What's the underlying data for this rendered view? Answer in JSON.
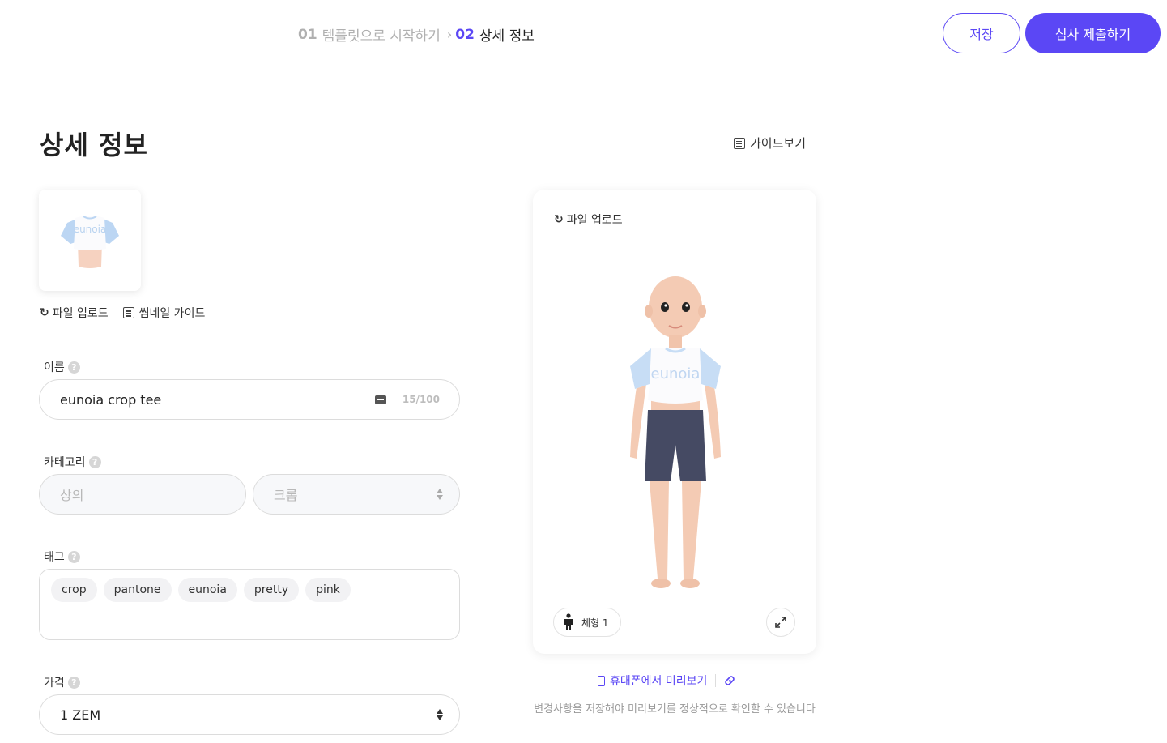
{
  "header": {
    "step1_num": "01",
    "step1_label": "템플릿으로 시작하기",
    "step2_num": "02",
    "step2_label": "상세 정보",
    "save_label": "저장",
    "submit_label": "심사 제출하기"
  },
  "page": {
    "title": "상세 정보",
    "guide_label": "가이드보기"
  },
  "thumbnail": {
    "shirt_text": "eunoia",
    "upload_label": "파일 업로드",
    "guide_label": "썸네일 가이드"
  },
  "form": {
    "name_label": "이름",
    "name_value": "eunoia crop tee",
    "name_counter": "15/100",
    "category_label": "카테고리",
    "category_main": "상의",
    "category_sub": "크롭",
    "tag_label": "태그",
    "tags": [
      "crop",
      "pantone",
      "eunoia",
      "pretty",
      "pink"
    ],
    "price_label": "가격",
    "price_value": "1 ZEM",
    "help_glyph": "?"
  },
  "preview": {
    "upload_label": "파일 업로드",
    "shirt_text": "eunoia",
    "body_type_label": "체형 1",
    "mobile_preview_label": "휴대폰에서 미리보기",
    "notice": "변경사항을 저장해야 미리보기를 정상적으로 확인할 수 있습니다"
  },
  "colors": {
    "accent": "#5b47f5",
    "muted": "#b0b0b0"
  }
}
